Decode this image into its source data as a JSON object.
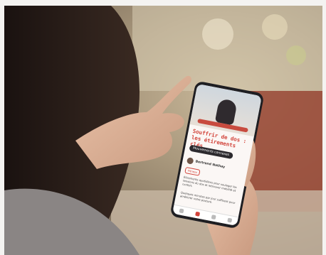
{
  "image": {
    "description_tag": "person-holding-phone-with-blog-app",
    "colors": {
      "accent": "#d2433a",
      "brick": "#9b4a38",
      "phone_frame": "#1e1e22"
    }
  },
  "phone_screen": {
    "title": "Souffrir de dos : les étirements clés",
    "tag_button": "Mouvements connexes",
    "author_name": "Bertrand Nathay",
    "chip": "Fitness",
    "paragraph_1": "Étirements quotidiens pour soulager les tensions du dos et retrouver mobilité et confort.",
    "paragraph_2": "Quelques minutes par jour suffisent pour améliorer votre posture."
  }
}
